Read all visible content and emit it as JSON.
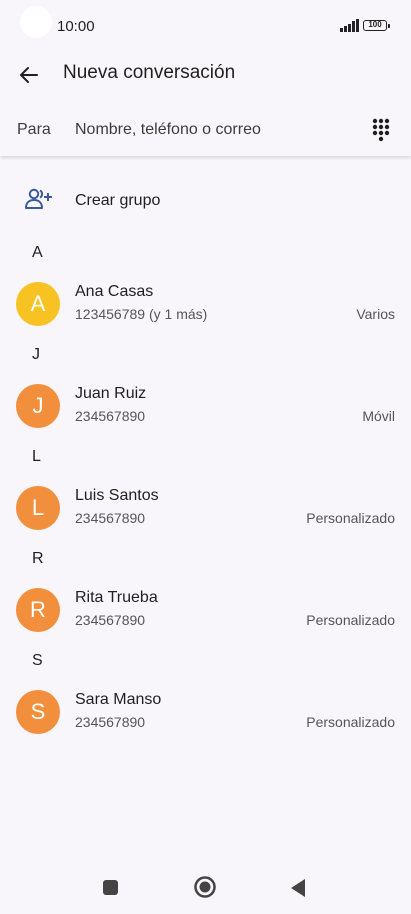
{
  "status": {
    "time": "10:00",
    "battery": "100"
  },
  "header": {
    "title": "Nueva conversación"
  },
  "to_field": {
    "label": "Para",
    "placeholder": "Nombre, teléfono o correo"
  },
  "create_group": {
    "label": "Crear grupo"
  },
  "sections": [
    {
      "letter": "A",
      "contacts": [
        {
          "initial": "A",
          "name": "Ana Casas",
          "phone": "123456789 (y 1 más)",
          "type": "Varios",
          "color": "#f6c323"
        }
      ]
    },
    {
      "letter": "J",
      "contacts": [
        {
          "initial": "J",
          "name": "Juan Ruiz",
          "phone": "234567890",
          "type": "Móvil",
          "color": "#f28f3d"
        }
      ]
    },
    {
      "letter": "L",
      "contacts": [
        {
          "initial": "L",
          "name": "Luis Santos",
          "phone": "234567890",
          "type": "Personalizado",
          "color": "#f28f3d"
        }
      ]
    },
    {
      "letter": "R",
      "contacts": [
        {
          "initial": "R",
          "name": "Rita Trueba",
          "phone": "234567890",
          "type": "Personalizado",
          "color": "#f28f3d"
        }
      ]
    },
    {
      "letter": "S",
      "contacts": [
        {
          "initial": "S",
          "name": "Sara Manso",
          "phone": "234567890",
          "type": "Personalizado",
          "color": "#f28f3d"
        }
      ]
    }
  ]
}
